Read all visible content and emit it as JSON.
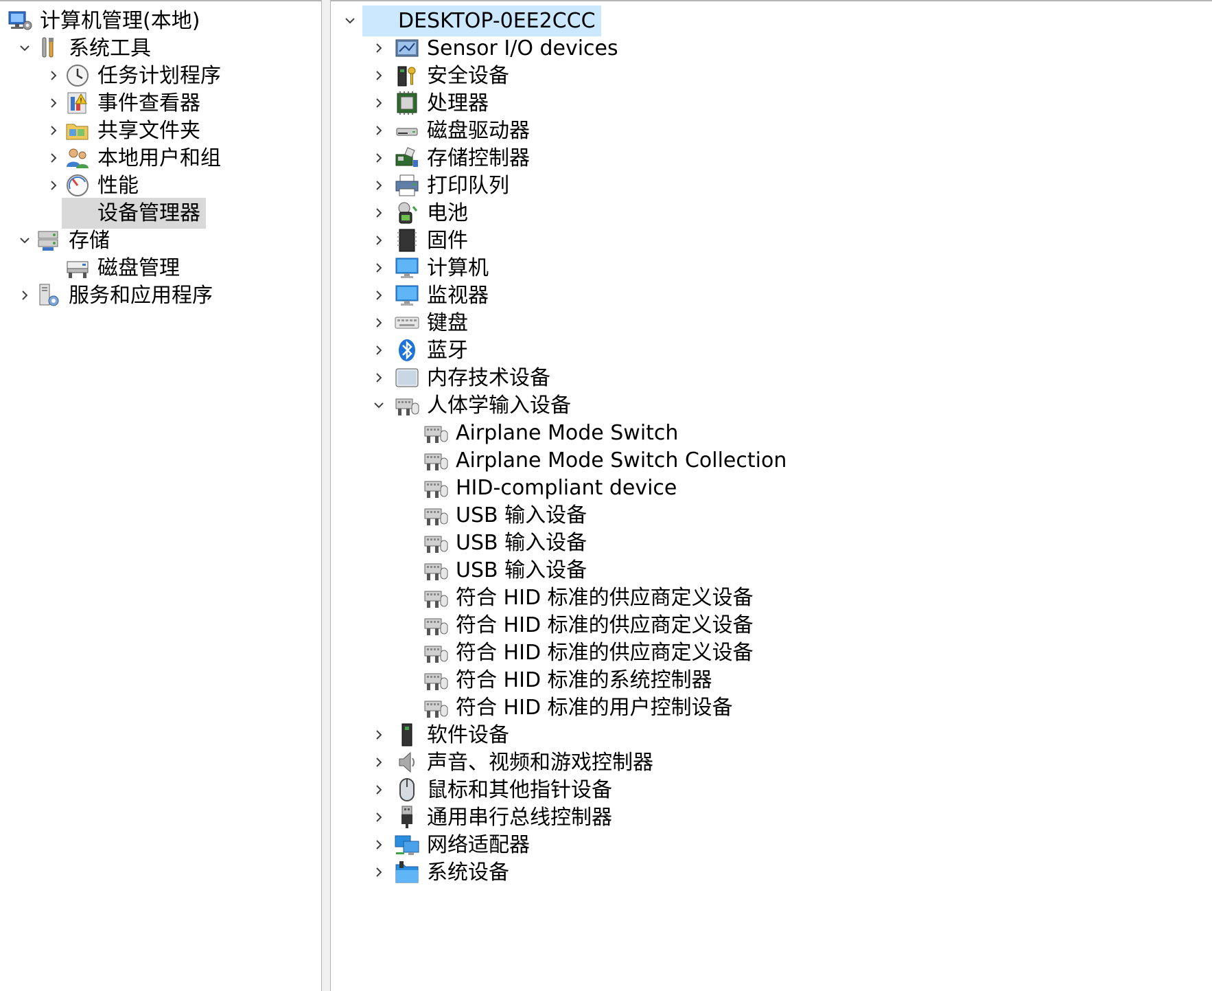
{
  "left_tree": [
    {
      "label": "计算机管理(本地)",
      "icon": "computer-management-icon",
      "chevron": "none"
    },
    {
      "label": "系统工具",
      "icon": "system-tools-icon",
      "chevron": "down"
    },
    {
      "label": "任务计划程序",
      "icon": "task-scheduler-icon",
      "chevron": "right"
    },
    {
      "label": "事件查看器",
      "icon": "event-viewer-icon",
      "chevron": "right"
    },
    {
      "label": "共享文件夹",
      "icon": "shared-folders-icon",
      "chevron": "right"
    },
    {
      "label": "本地用户和组",
      "icon": "local-users-icon",
      "chevron": "right"
    },
    {
      "label": "性能",
      "icon": "performance-icon",
      "chevron": "right"
    },
    {
      "label": "设备管理器",
      "icon": "device-manager-icon",
      "chevron": "none",
      "selected": true
    },
    {
      "label": "存储",
      "icon": "storage-icon",
      "chevron": "down"
    },
    {
      "label": "磁盘管理",
      "icon": "disk-management-icon",
      "chevron": "none"
    },
    {
      "label": "服务和应用程序",
      "icon": "services-apps-icon",
      "chevron": "right"
    }
  ],
  "right_tree": {
    "root": {
      "label": "DESKTOP-0EE2CCC",
      "icon": "computer-node-icon",
      "chevron": "down"
    },
    "categories": [
      {
        "label": "Sensor I/O devices",
        "icon": "sensor-icon",
        "chevron": "right"
      },
      {
        "label": "安全设备",
        "icon": "security-device-icon",
        "chevron": "right"
      },
      {
        "label": "处理器",
        "icon": "processor-icon",
        "chevron": "right"
      },
      {
        "label": "磁盘驱动器",
        "icon": "disk-drive-icon",
        "chevron": "right"
      },
      {
        "label": "存储控制器",
        "icon": "storage-controller-icon",
        "chevron": "right"
      },
      {
        "label": "打印队列",
        "icon": "printer-icon",
        "chevron": "right"
      },
      {
        "label": "电池",
        "icon": "battery-icon",
        "chevron": "right"
      },
      {
        "label": "固件",
        "icon": "firmware-icon",
        "chevron": "right"
      },
      {
        "label": "计算机",
        "icon": "computer-icon",
        "chevron": "right"
      },
      {
        "label": "监视器",
        "icon": "monitor-icon",
        "chevron": "right"
      },
      {
        "label": "键盘",
        "icon": "keyboard-icon",
        "chevron": "right"
      },
      {
        "label": "蓝牙",
        "icon": "bluetooth-icon",
        "chevron": "right"
      },
      {
        "label": "内存技术设备",
        "icon": "memory-tech-icon",
        "chevron": "right"
      },
      {
        "label": "人体学输入设备",
        "icon": "hid-icon",
        "chevron": "down",
        "children": [
          "Airplane Mode Switch",
          "Airplane Mode Switch Collection",
          "HID-compliant device",
          "USB 输入设备",
          "USB 输入设备",
          "USB 输入设备",
          "符合 HID 标准的供应商定义设备",
          "符合 HID 标准的供应商定义设备",
          "符合 HID 标准的供应商定义设备",
          "符合 HID 标准的系统控制器",
          "符合 HID 标准的用户控制设备"
        ]
      },
      {
        "label": "软件设备",
        "icon": "software-device-icon",
        "chevron": "right"
      },
      {
        "label": "声音、视频和游戏控制器",
        "icon": "speaker-icon",
        "chevron": "right"
      },
      {
        "label": "鼠标和其他指针设备",
        "icon": "mouse-icon",
        "chevron": "right"
      },
      {
        "label": "通用串行总线控制器",
        "icon": "usb-icon",
        "chevron": "right"
      },
      {
        "label": "网络适配器",
        "icon": "network-adapter-icon",
        "chevron": "right"
      },
      {
        "label": "系统设备",
        "icon": "system-device-icon",
        "chevron": "right"
      }
    ]
  },
  "colors": {
    "selected_gray": "#d9d9d9",
    "selected_blue": "#cce8ff",
    "chevron": "#404040",
    "splitter": "#f0f0f0"
  }
}
